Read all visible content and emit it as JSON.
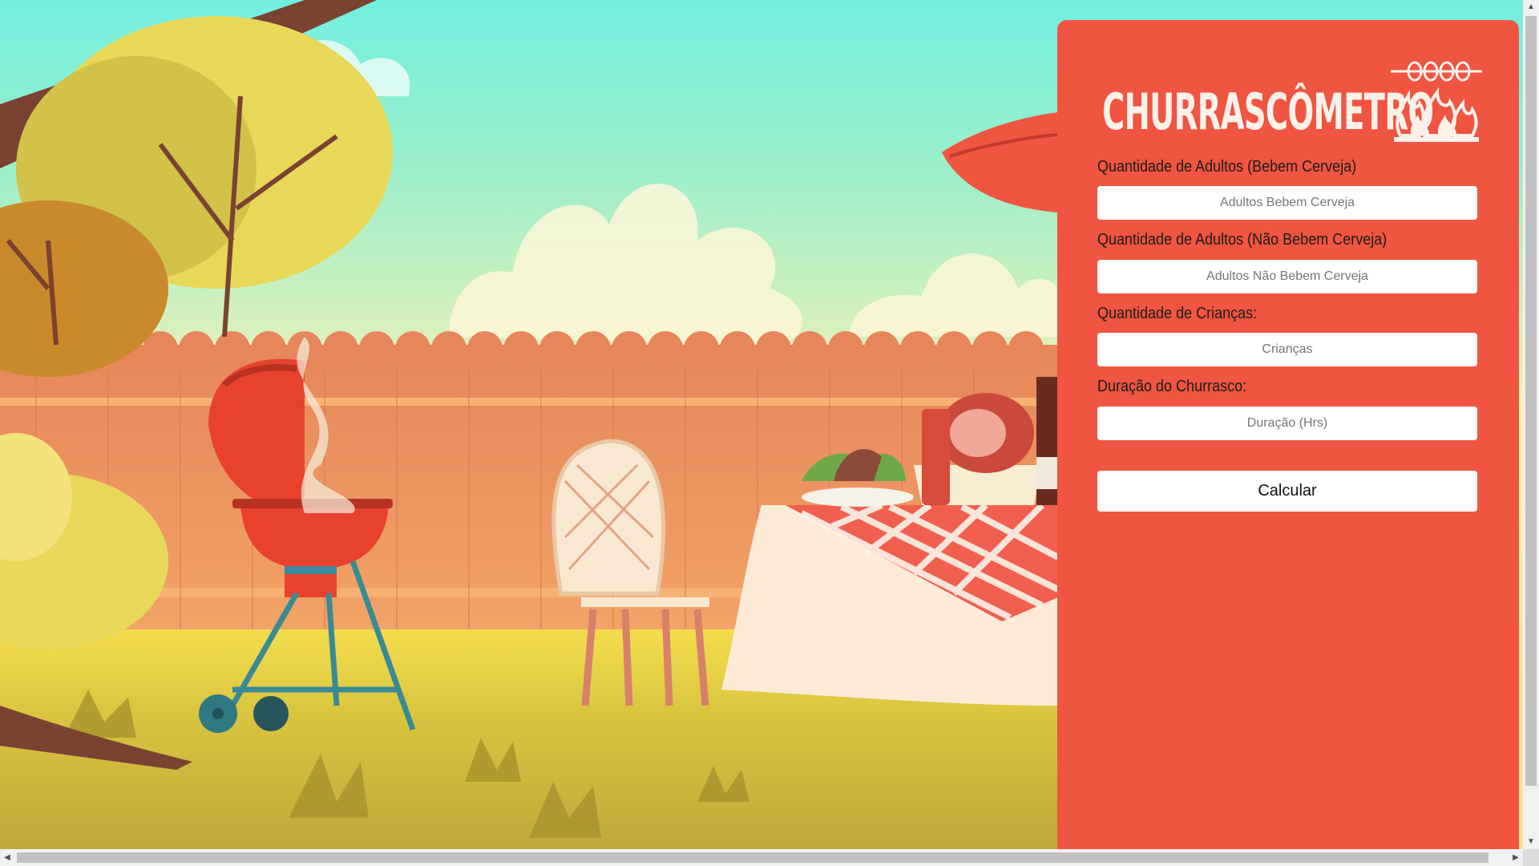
{
  "app": {
    "logo_text": "CHURRASCÔMETRO",
    "logo_icon": "grill-fire-icon"
  },
  "form": {
    "fields": [
      {
        "label": "Quantidade de Adultos (Bebem Cerveja)",
        "placeholder": "Adultos Bebem Cerveja",
        "value": ""
      },
      {
        "label": "Quantidade de Adultos (Não Bebem Cerveja)",
        "placeholder": "Adultos Não Bebem Cerveja",
        "value": ""
      },
      {
        "label": "Quantidade de Crianças:",
        "placeholder": "Crianças",
        "value": ""
      },
      {
        "label": "Duração do Churrasco:",
        "placeholder": "Duração (Hrs)",
        "value": ""
      }
    ],
    "submit_label": "Calcular"
  },
  "background": {
    "description_icon": "backyard-barbecue-illustration"
  },
  "colors": {
    "panel": "#ef5540",
    "input_bg": "#ffffff",
    "logo": "#fdf1ea"
  },
  "scrollbars": {
    "up_icon": "▲",
    "down_icon": "▼",
    "left_icon": "◀",
    "right_icon": "▶"
  }
}
